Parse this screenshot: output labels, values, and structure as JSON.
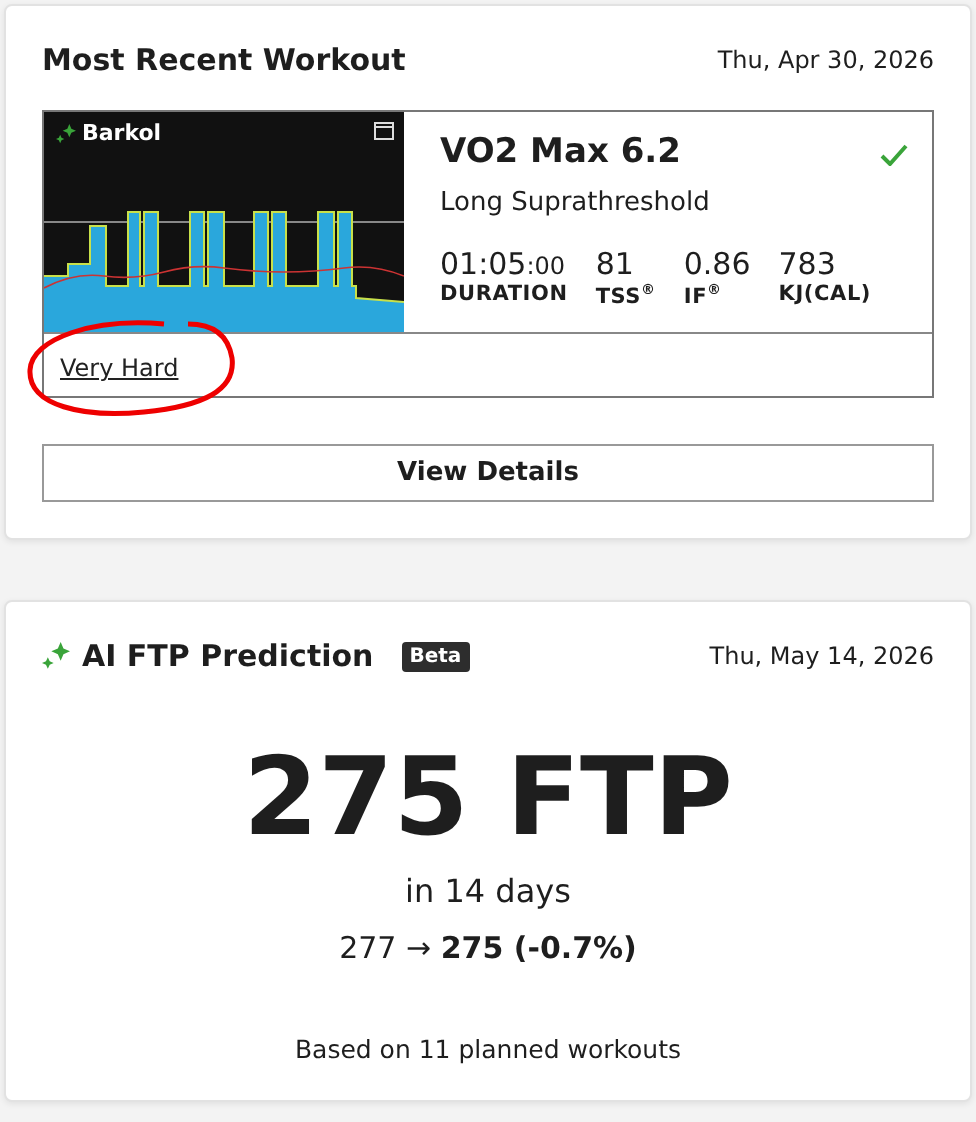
{
  "workout_card": {
    "title": "Most Recent Workout",
    "date": "Thu, Apr 30, 2026",
    "workout": {
      "brand": "Barkol",
      "name": "VO2 Max 6.2",
      "subtitle": "Long Suprathreshold",
      "completed": true,
      "stats": [
        {
          "value": "01:05",
          "small": ":00",
          "label": "DURATION"
        },
        {
          "value": "81",
          "label": "TSS$^{®}$"
        },
        {
          "value": "0.86",
          "label": "IF$^{®}$"
        },
        {
          "value": "783",
          "label": "KJ(CAL)"
        }
      ],
      "difficulty": "Very Hard"
    },
    "button": "View Details"
  },
  "prediction_card": {
    "title": "AI FTP Prediction",
    "badge": "Beta",
    "date": "Thu, May 14, 2026",
    "value": "275 FTP",
    "period": "in 14 days",
    "change": "277 → **275 (-0.7%)**",
    "note": "Based on 11 planned workouts"
  }
}
